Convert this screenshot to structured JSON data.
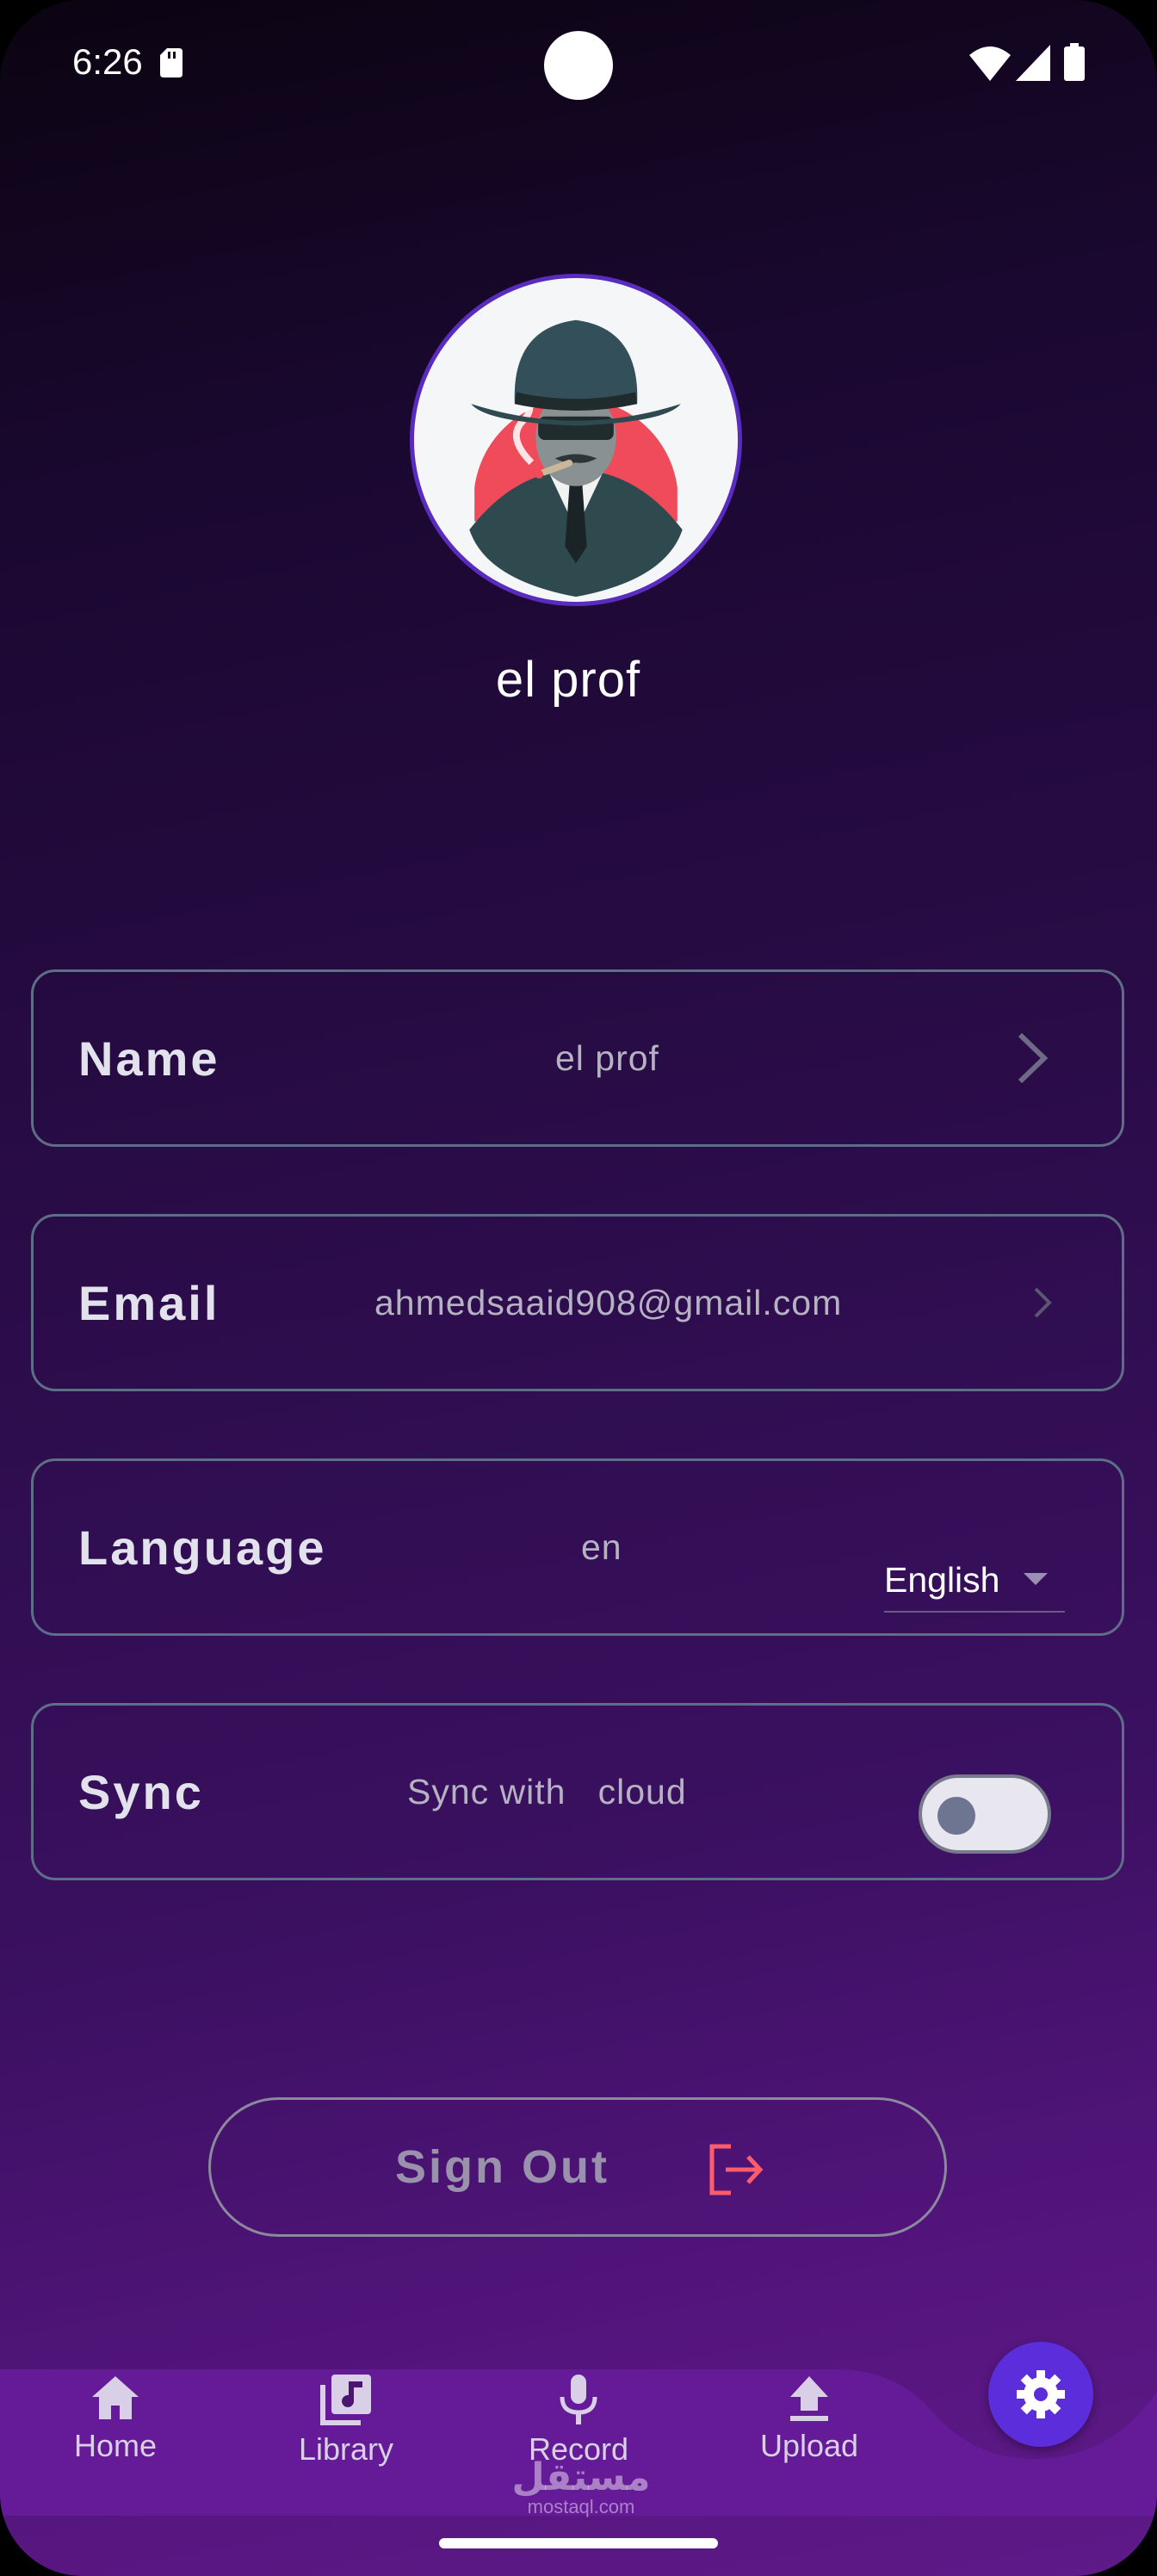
{
  "status_bar": {
    "time": "6:26"
  },
  "profile": {
    "display_name": "el prof"
  },
  "settings": {
    "name": {
      "label": "Name",
      "value": "el prof"
    },
    "email": {
      "label": "Email",
      "value": "ahmedsaaid908@gmail.com"
    },
    "language": {
      "label": "Language",
      "value": "en",
      "selected_option": "English"
    },
    "sync": {
      "label": "Sync",
      "value": "Sync with   cloud",
      "enabled": false
    }
  },
  "actions": {
    "sign_out_label": "Sign Out"
  },
  "bottom_nav": {
    "items": [
      {
        "label": "Home",
        "icon": "home-icon"
      },
      {
        "label": "Library",
        "icon": "library-music-icon"
      },
      {
        "label": "Record",
        "icon": "microphone-icon"
      },
      {
        "label": "Upload",
        "icon": "upload-icon"
      }
    ],
    "fab_icon": "gear-icon"
  },
  "watermark": {
    "arabic": "مستقل",
    "latin": "mostaql.com"
  },
  "colors": {
    "accent": "#5b2ddb",
    "card_border": "#5e6e86",
    "sign_out_icon": "#ff5c6c",
    "nav_background": "#651b97"
  }
}
